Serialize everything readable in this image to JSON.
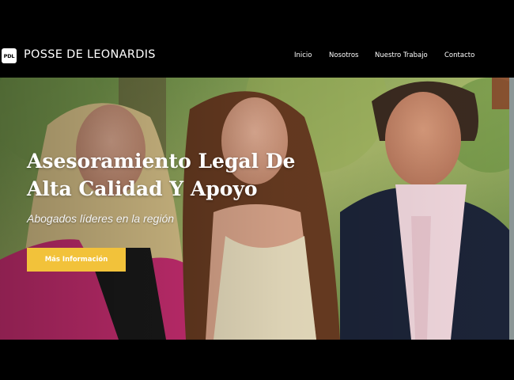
{
  "brand": {
    "logo_text": "PDL",
    "name": "POSSE DE LEONARDIS"
  },
  "nav": {
    "items": [
      {
        "label": "Inicio"
      },
      {
        "label": "Nosotros"
      },
      {
        "label": "Nuestro Trabajo"
      },
      {
        "label": "Contacto"
      }
    ]
  },
  "hero": {
    "title_line1": "Asesoramiento Legal De",
    "title_line2": "Alta Calidad Y Apoyo",
    "subtitle": "Abogados líderes en la región",
    "cta_label": "Más Información"
  },
  "colors": {
    "navbar_bg": "#000000",
    "cta_bg": "#f2c23a",
    "text": "#ffffff"
  }
}
